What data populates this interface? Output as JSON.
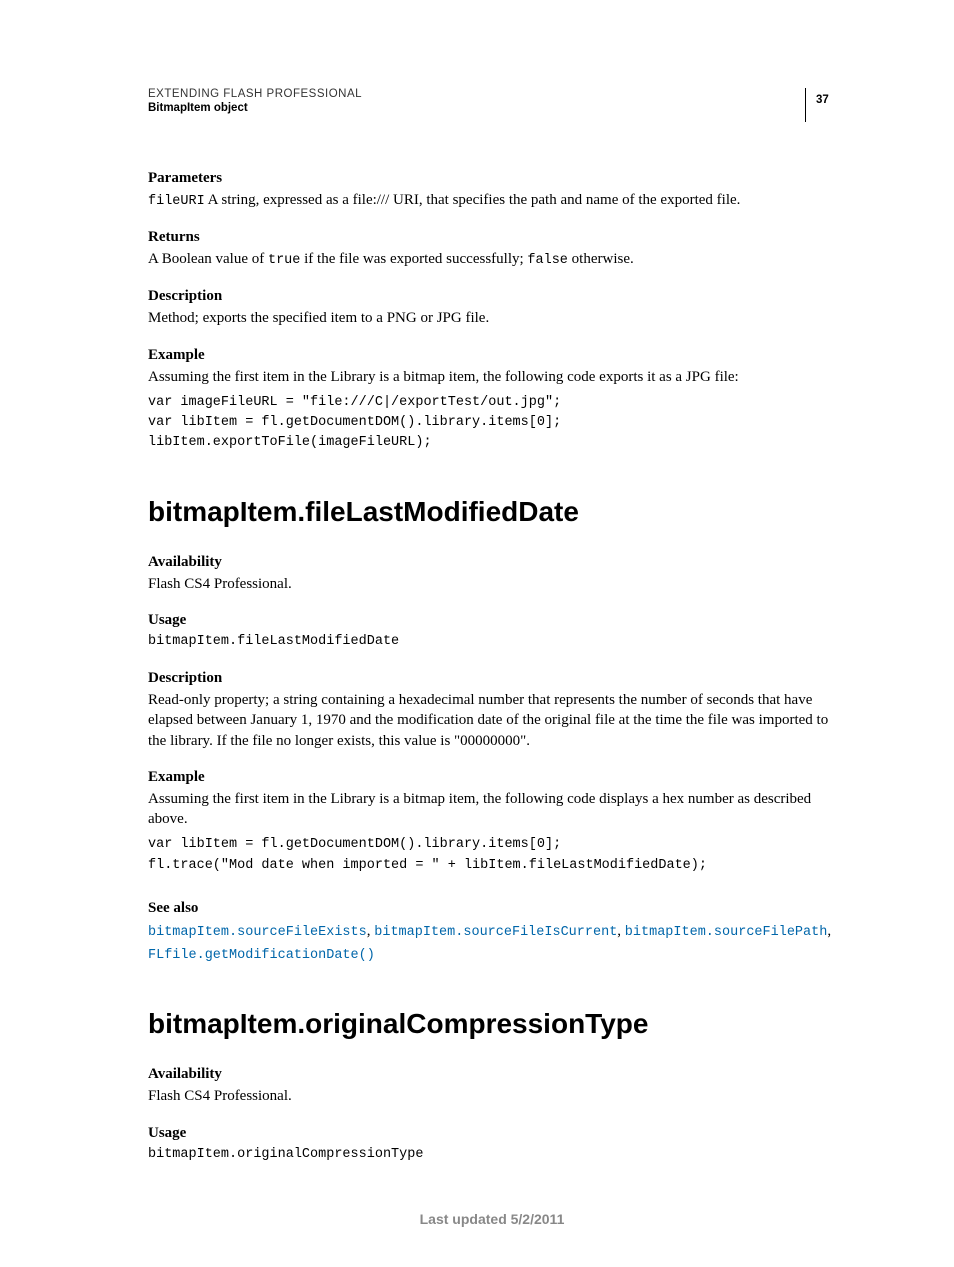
{
  "header": {
    "doc_title": "EXTENDING FLASH PROFESSIONAL",
    "doc_subtitle": "BitmapItem object",
    "page_number": "37"
  },
  "section1": {
    "parameters_label": "Parameters",
    "parameters_code": "fileURI",
    "parameters_text": "  A string, expressed as a file:/// URI, that specifies the path and name of the exported file.",
    "returns_label": "Returns",
    "returns_part1": "A Boolean value of ",
    "returns_code1": "true",
    "returns_part2": " if the file was exported successfully; ",
    "returns_code2": "false",
    "returns_part3": " otherwise.",
    "description_label": "Description",
    "description_text": "Method; exports the specified item to a PNG or JPG file.",
    "example_label": "Example",
    "example_intro": "Assuming the first item in the Library is a bitmap item, the following code exports it as a JPG file:",
    "example_code": "var imageFileURL = \"file:///C|/exportTest/out.jpg\";\nvar libItem = fl.getDocumentDOM().library.items[0];\nlibItem.exportToFile(imageFileURL);"
  },
  "section2": {
    "heading": "bitmapItem.fileLastModifiedDate",
    "availability_label": "Availability",
    "availability_text": "Flash CS4 Professional.",
    "usage_label": "Usage",
    "usage_code": "bitmapItem.fileLastModifiedDate",
    "description_label": "Description",
    "description_text": "Read-only property; a string containing a hexadecimal number that represents the number of seconds that have elapsed between January 1, 1970 and the modification date of the original file at the time the file was imported to the library. If the file no longer exists, this value is \"00000000\".",
    "example_label": "Example",
    "example_intro": "Assuming the first item in the Library is a bitmap item, the following code displays a hex number as described above.",
    "example_code": "var libItem = fl.getDocumentDOM().library.items[0];\nfl.trace(\"Mod date when imported = \" + libItem.fileLastModifiedDate);",
    "seealso_label": "See also",
    "seealso_links": {
      "l1": "bitmapItem.sourceFileExists",
      "l2": "bitmapItem.sourceFileIsCurrent",
      "l3": "bitmapItem.sourceFilePath",
      "l4": "FLfile.getModificationDate()"
    }
  },
  "section3": {
    "heading": "bitmapItem.originalCompressionType",
    "availability_label": "Availability",
    "availability_text": "Flash CS4 Professional.",
    "usage_label": "Usage",
    "usage_code": "bitmapItem.originalCompressionType"
  },
  "footer": {
    "last_updated": "Last updated 5/2/2011"
  }
}
